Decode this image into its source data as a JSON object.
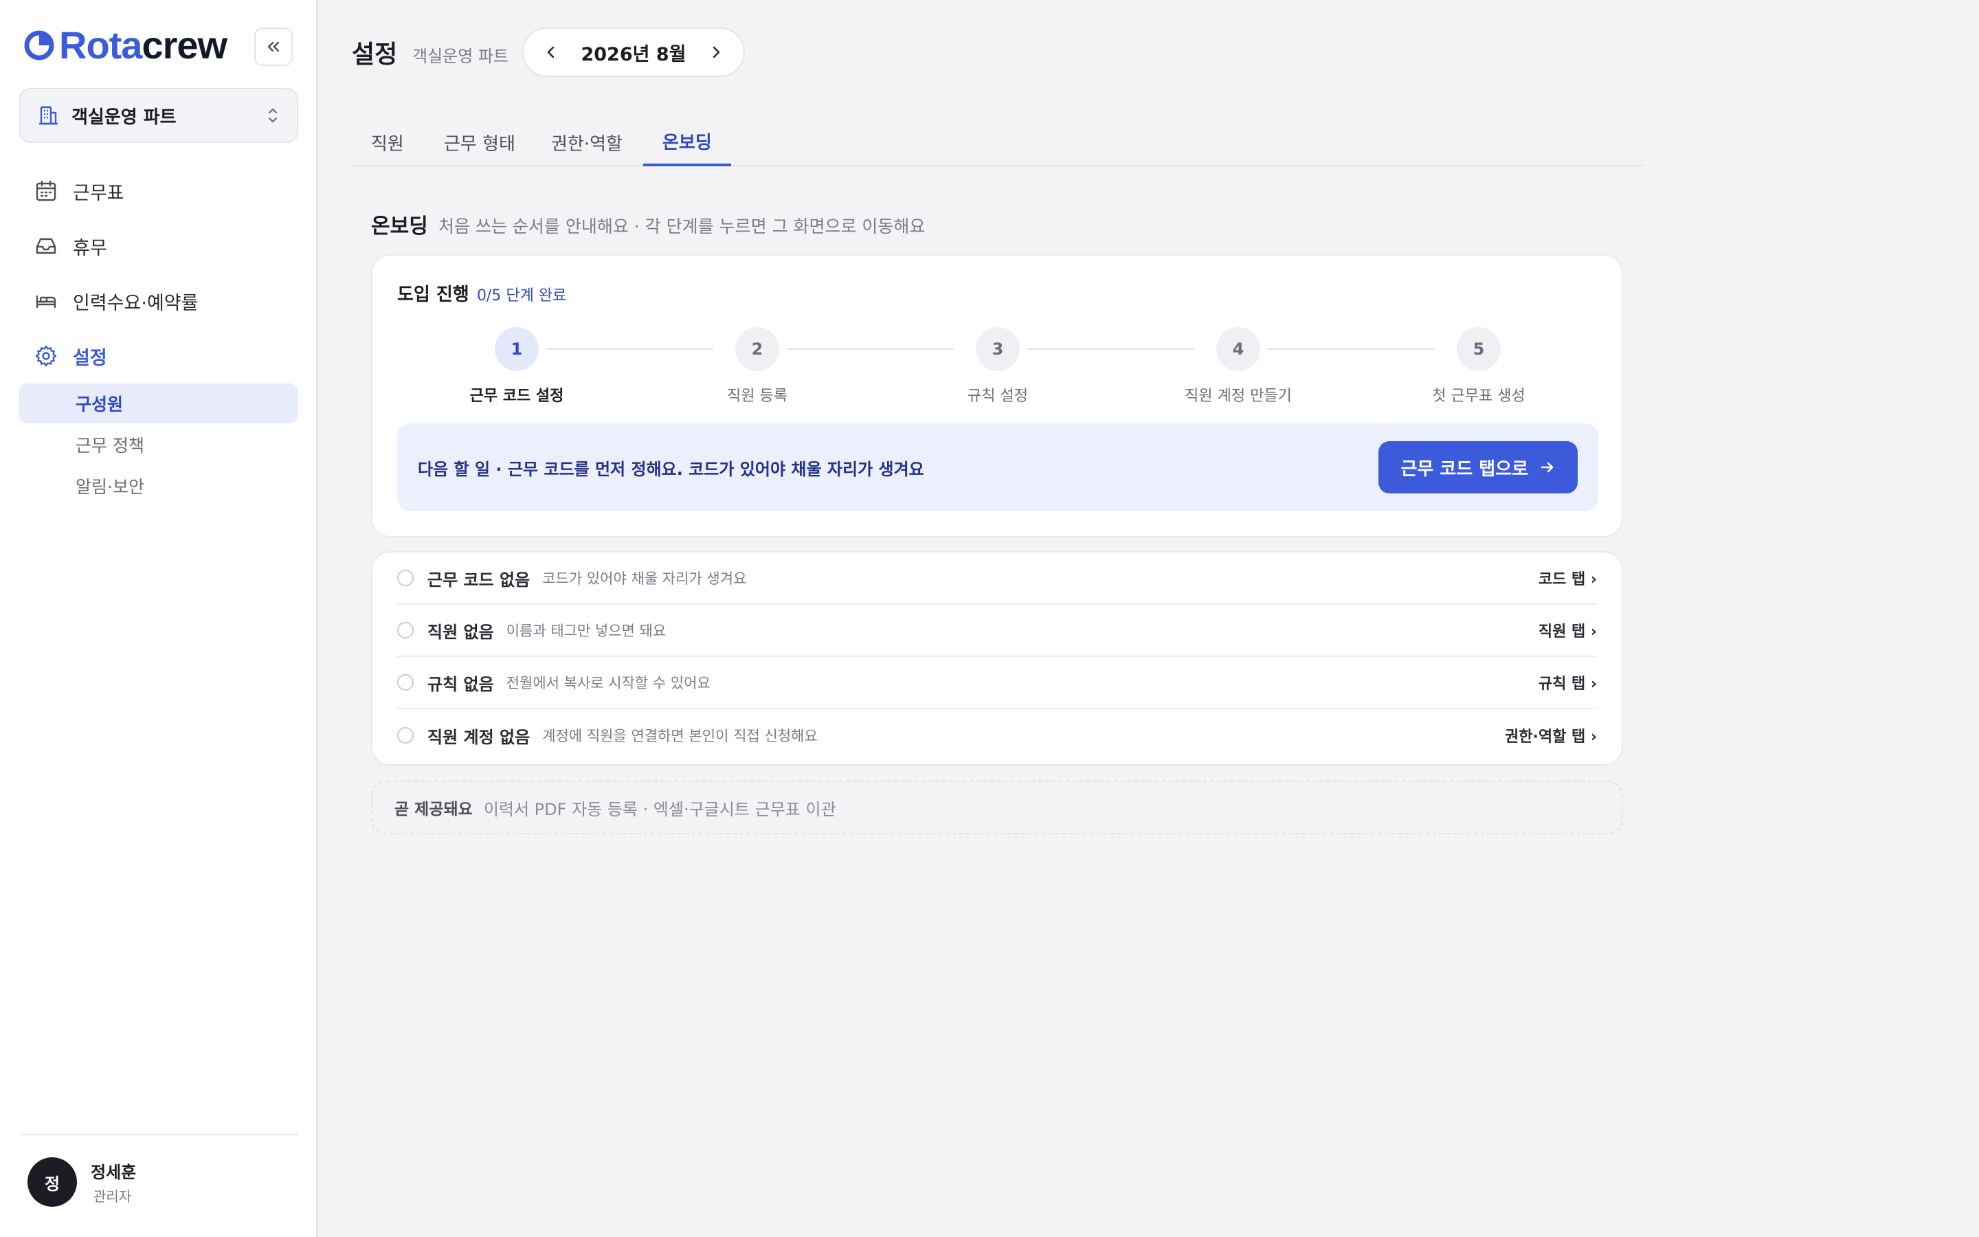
{
  "brand": {
    "name_part1": "Rota",
    "name_part2": "crew",
    "accent": "#3b5bdb"
  },
  "sidebar": {
    "team": {
      "label": "객실운영 파트",
      "icon": "building-icon"
    },
    "nav": [
      {
        "label": "근무표",
        "icon": "calendar-icon"
      },
      {
        "label": "휴무",
        "icon": "inbox-icon"
      },
      {
        "label": "인력수요·예약률",
        "icon": "bed-icon"
      },
      {
        "label": "설정",
        "icon": "gear-icon",
        "active": true
      }
    ],
    "sub": [
      {
        "label": "구성원",
        "active": true
      },
      {
        "label": "근무 정책"
      },
      {
        "label": "알림·보안"
      }
    ],
    "user": {
      "initial": "정",
      "name": "정세훈",
      "role": "관리자"
    }
  },
  "header": {
    "title": "설정",
    "subtitle": "객실운영 파트",
    "month": "2026년 8월"
  },
  "tabs": [
    {
      "label": "직원"
    },
    {
      "label": "근무 형태"
    },
    {
      "label": "권한·역할"
    },
    {
      "label": "온보딩",
      "active": true
    }
  ],
  "onboarding": {
    "title": "온보딩",
    "description": "처음 쓰는 순서를 안내해요 · 각 단계를 누르면 그 화면으로 이동해요",
    "progress": {
      "title": "도입 진행",
      "count": "0/5 단계 완료",
      "completed": 0,
      "total": 5,
      "steps": [
        {
          "num": "1",
          "label": "근무 코드 설정",
          "current": true
        },
        {
          "num": "2",
          "label": "직원 등록"
        },
        {
          "num": "3",
          "label": "규칙 설정"
        },
        {
          "num": "4",
          "label": "직원 계정 만들기"
        },
        {
          "num": "5",
          "label": "첫 근무표 생성"
        }
      ]
    },
    "next": {
      "text": "다음 할 일 · 근무 코드를 먼저 정해요. 코드가 있어야 채울 자리가 생겨요",
      "button": "근무 코드 탭으로"
    },
    "checklist": [
      {
        "title": "근무 코드 없음",
        "desc": "코드가 있어야 채울 자리가 생겨요",
        "link": "코드 탭 ›"
      },
      {
        "title": "직원 없음",
        "desc": "이름과 태그만 넣으면 돼요",
        "link": "직원 탭 ›"
      },
      {
        "title": "규칙 없음",
        "desc": "전월에서 복사로 시작할 수 있어요",
        "link": "규칙 탭 ›"
      },
      {
        "title": "직원 계정 없음",
        "desc": "계정에 직원을 연결하면 본인이 직접 신청해요",
        "link": "권한·역할 탭 ›"
      }
    ],
    "soon": {
      "label": "곧 제공돼요",
      "text": "이력서 PDF 자동 등록 · 엑셀·구글시트 근무표 이관"
    }
  }
}
